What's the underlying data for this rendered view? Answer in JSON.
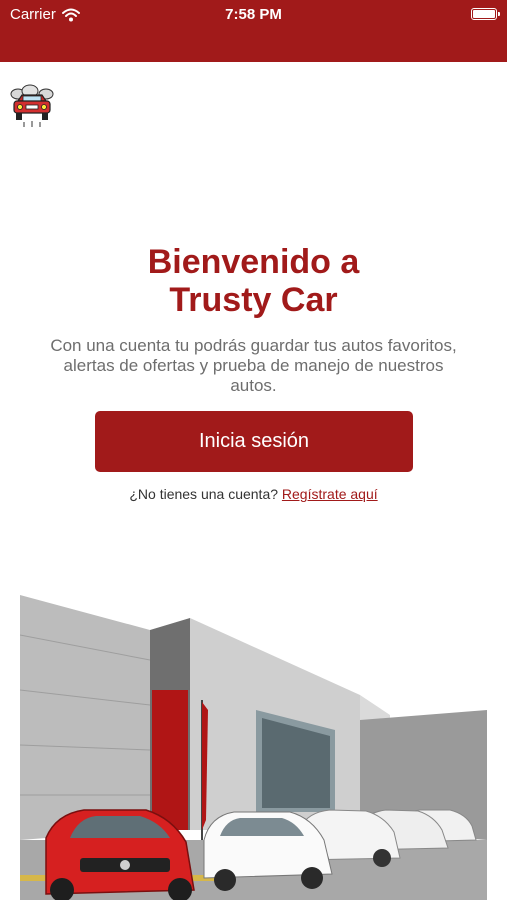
{
  "status_bar": {
    "carrier": "Carrier",
    "time": "7:58 PM"
  },
  "welcome": {
    "title_line1": "Bienvenido a",
    "title_line2": "Trusty Car",
    "description": "Con una cuenta tu podrás guardar tus autos favoritos, alertas de ofertas y prueba de manejo de nuestros autos."
  },
  "login_button": "Inicia sesión",
  "register": {
    "prompt": "¿No tienes una cuenta?",
    "link": "Regístrate aquí"
  },
  "colors": {
    "brand": "#a11a1a",
    "text_gray": "#6e6e6e"
  },
  "icons": [
    "wifi-icon",
    "battery-icon",
    "car-logo-icon"
  ]
}
